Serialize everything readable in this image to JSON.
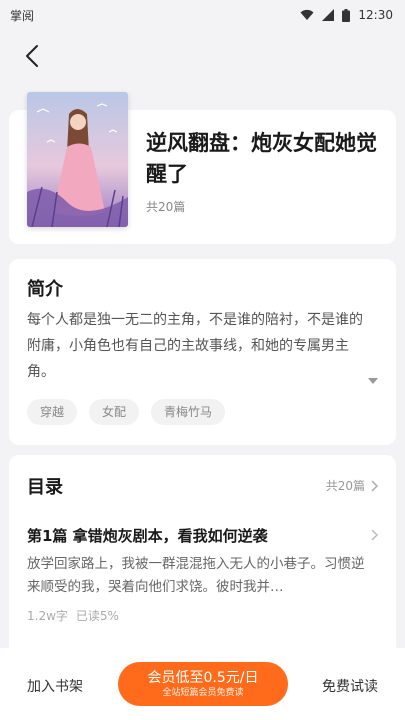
{
  "status_bar": {
    "app_name": "掌阅",
    "time": "12:30"
  },
  "book": {
    "title": "逆风翻盘：炮灰女配她觉醒了",
    "count": "共20篇"
  },
  "intro": {
    "heading": "简介",
    "text": "每个人都是独一无二的主角，不是谁的陪衬，不是谁的附庸，小角色也有自己的主故事线，和她的专属男主角。",
    "tags": [
      "穿越",
      "女配",
      "青梅竹马"
    ]
  },
  "toc": {
    "heading": "目录",
    "count": "共20篇",
    "chapter": {
      "title": "第1篇 拿错炮灰剧本，看我如何逆袭",
      "preview": "放学回家路上，我被一群混混拖入无人的小巷子。习惯逆来顺受的我，哭着向他们求饶。彼时我并…",
      "words": "1.2w字",
      "read": "已读5%"
    }
  },
  "bottom": {
    "add_shelf": "加入书架",
    "vip_main": "会员低至0.5元/日",
    "vip_sub": "全站短篇会员免费读",
    "free_trial": "免费试读"
  },
  "colors": {
    "accent": "#ff6b1a"
  },
  "icons": [
    "back-arrow-icon",
    "wifi-icon",
    "signal-icon",
    "battery-icon",
    "expand-down-icon",
    "chevron-right-icon"
  ]
}
